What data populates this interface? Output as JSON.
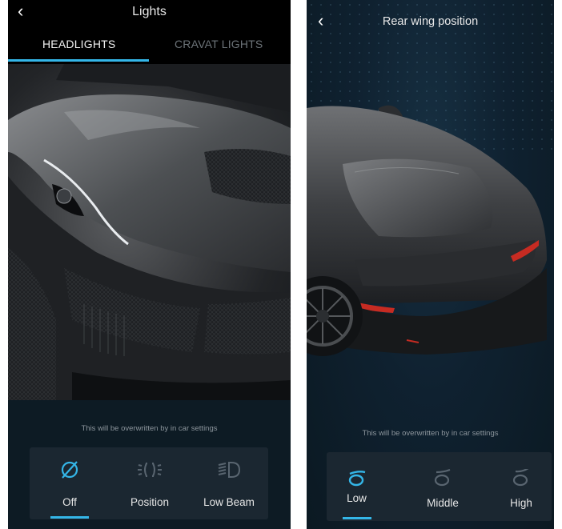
{
  "left_screen": {
    "title": "Lights",
    "back_glyph": "‹",
    "tabs": [
      {
        "label": "HEADLIGHTS",
        "active": true
      },
      {
        "label": "CRAVAT LIGHTS",
        "active": false
      }
    ],
    "note": "This will be overwritten by in car settings",
    "options": [
      {
        "label": "Off",
        "icon": "lights-off-icon",
        "selected": true
      },
      {
        "label": "Position",
        "icon": "position-lights-icon",
        "selected": false
      },
      {
        "label": "Low Beam",
        "icon": "low-beam-icon",
        "selected": false
      }
    ]
  },
  "right_screen": {
    "title": "Rear wing position",
    "back_glyph": "‹",
    "note": "This will be overwritten by in car settings",
    "options": [
      {
        "label": "Low",
        "icon": "wing-low-icon",
        "selected": true
      },
      {
        "label": "Middle",
        "icon": "wing-middle-icon",
        "selected": false
      },
      {
        "label": "High",
        "icon": "wing-high-icon",
        "selected": false
      }
    ]
  },
  "colors": {
    "accent": "#34b6e8",
    "background": "#0d1b24",
    "panel": "#1b2731",
    "inactive_icon": "#596570",
    "tail_light": "#c62b22"
  }
}
